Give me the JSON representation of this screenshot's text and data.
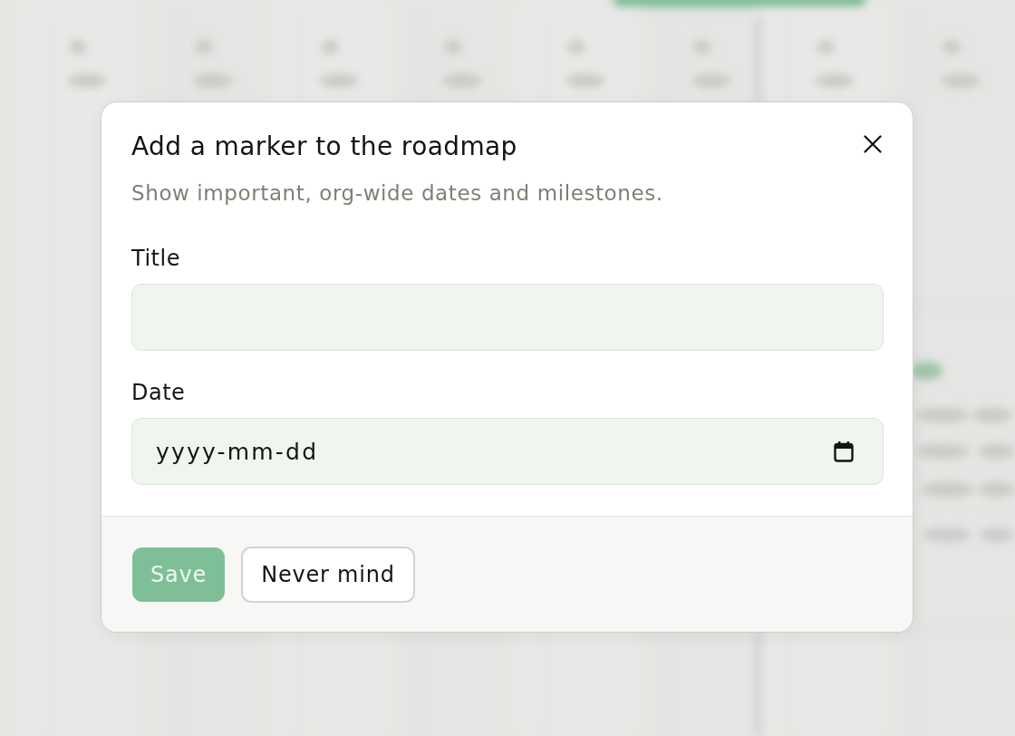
{
  "dialog": {
    "title": "Add a marker to the roadmap",
    "subtitle": "Show important, org-wide dates and milestones.",
    "fields": [
      {
        "kind": "text",
        "label": "Title"
      },
      {
        "kind": "date",
        "label": "Date",
        "placeholder": "yyyy-mm-dd"
      }
    ],
    "buttons": [
      {
        "kind": "primary",
        "label": "Save",
        "disabled": true
      },
      {
        "kind": "secondary",
        "label": "Never mind",
        "disabled": false
      }
    ]
  }
}
